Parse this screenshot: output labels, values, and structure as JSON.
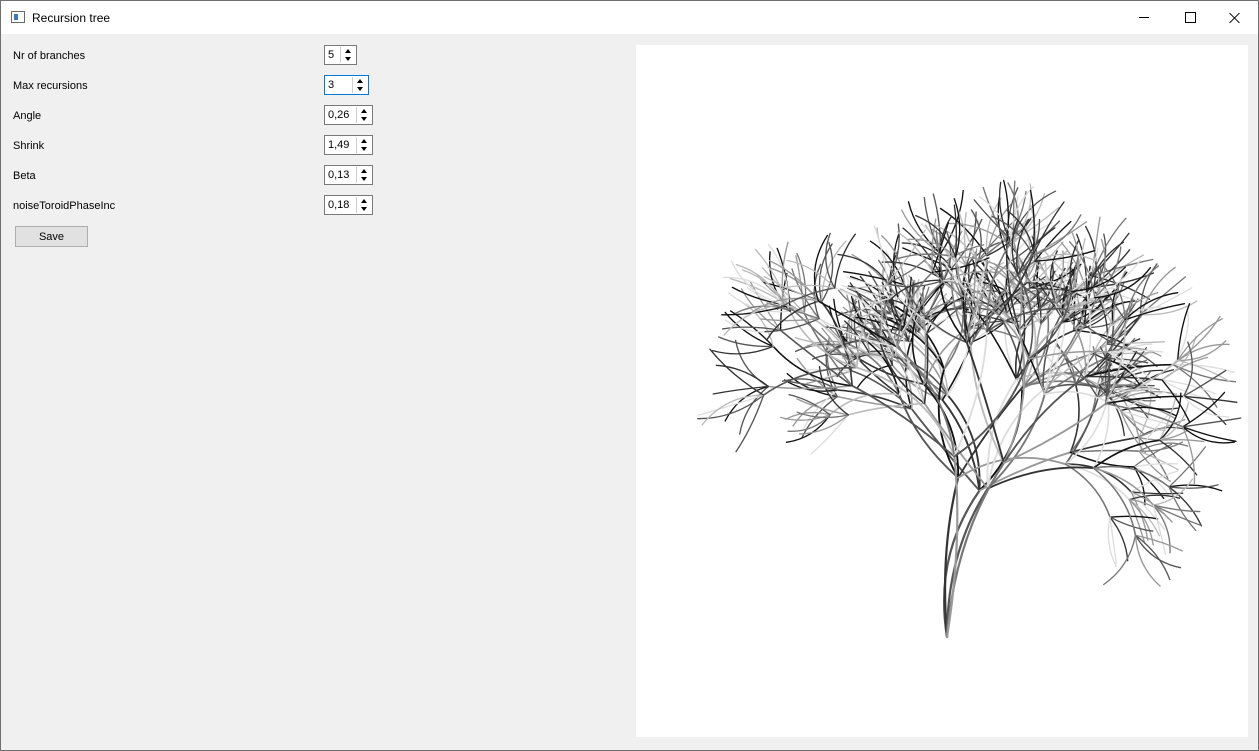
{
  "window": {
    "title": "Recursion tree",
    "app_icon": "window-app-icon"
  },
  "titlebar_buttons": [
    "minimize-icon",
    "maximize-icon",
    "close-icon"
  ],
  "controls": [
    {
      "label": "Nr of branches",
      "value": "5"
    },
    {
      "label": "Max recursions",
      "value": "3"
    },
    {
      "label": "Angle",
      "value": "0,26"
    },
    {
      "label": "Shrink",
      "value": "1,49"
    },
    {
      "label": "Beta",
      "value": "0,13"
    },
    {
      "label": "noiseToroidPhaseInc",
      "value": "0,18"
    }
  ],
  "save_label": "Save",
  "colors": {
    "panel_bg": "#f0f0f0",
    "canvas_bg": "#ffffff",
    "focus_border": "#0078d7",
    "branch_tones": [
      "#111111",
      "#333333",
      "#555555",
      "#777777",
      "#999999",
      "#bbbbbb",
      "#dddddd"
    ]
  }
}
